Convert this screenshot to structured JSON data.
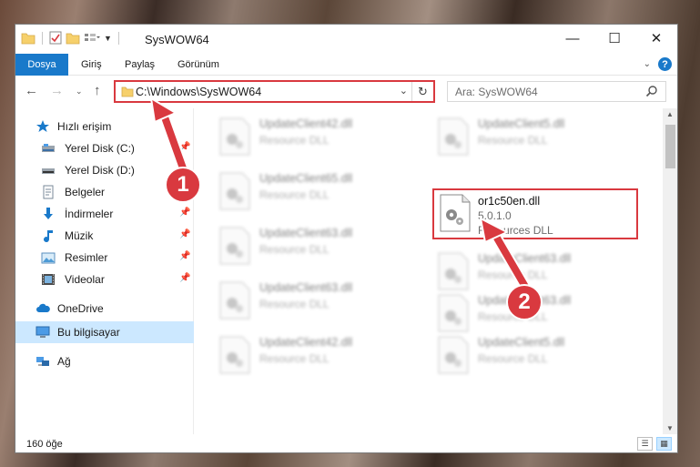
{
  "window": {
    "title": "SysWOW64",
    "minimize_glyph": "—",
    "maximize_glyph": "☐",
    "close_glyph": "✕"
  },
  "ribbon": {
    "tabs": [
      {
        "label": "Dosya",
        "active": true
      },
      {
        "label": "Giriş",
        "active": false
      },
      {
        "label": "Paylaş",
        "active": false
      },
      {
        "label": "Görünüm",
        "active": false
      }
    ]
  },
  "nav": {
    "address": "C:\\Windows\\SysWOW64",
    "search_placeholder": "Ara: SysWOW64"
  },
  "sidebar": {
    "quick_access": "Hızlı erişim",
    "items": [
      {
        "label": "Yerel Disk (C:)",
        "icon": "drive-icon",
        "pinned": true
      },
      {
        "label": "Yerel Disk (D:)",
        "icon": "drive-icon",
        "pinned": false
      },
      {
        "label": "Belgeler",
        "icon": "documents-icon",
        "pinned": true
      },
      {
        "label": "İndirmeler",
        "icon": "download-icon",
        "pinned": true
      },
      {
        "label": "Müzik",
        "icon": "music-icon",
        "pinned": true
      },
      {
        "label": "Resimler",
        "icon": "pictures-icon",
        "pinned": true
      },
      {
        "label": "Videolar",
        "icon": "videos-icon",
        "pinned": true
      }
    ],
    "onedrive": "OneDrive",
    "this_pc": "Bu bilgisayar",
    "network": "Ağ"
  },
  "files": {
    "left": [
      {
        "name": "UpdateClient42.dll",
        "desc": "Resource DLL"
      },
      {
        "name": "UpdateClient65.dll",
        "desc": "Resource DLL"
      },
      {
        "name": "UpdateClient63.dll",
        "desc": "Resource DLL"
      },
      {
        "name": "UpdateClient63.dll",
        "desc": "Resource DLL"
      },
      {
        "name": "UpdateClient42.dll",
        "desc": "Resource DLL"
      }
    ],
    "right": [
      {
        "name": "UpdateClient5.dll",
        "desc": "Resource DLL"
      },
      {
        "name": "UpdateClient63.dll",
        "desc": "Resource DLL"
      },
      {
        "name": "UpdateClient63.dll",
        "desc": "Resource DLL"
      },
      {
        "name": "UpdateClient5.dll",
        "desc": "Resource DLL"
      }
    ],
    "highlighted": {
      "name": "or1c50en.dll",
      "version": "5.0.1.0",
      "desc": "Resources DLL"
    }
  },
  "status": {
    "count": "160 öğe"
  },
  "annotations": {
    "step1": "1",
    "step2": "2",
    "color": "#d9393f"
  }
}
